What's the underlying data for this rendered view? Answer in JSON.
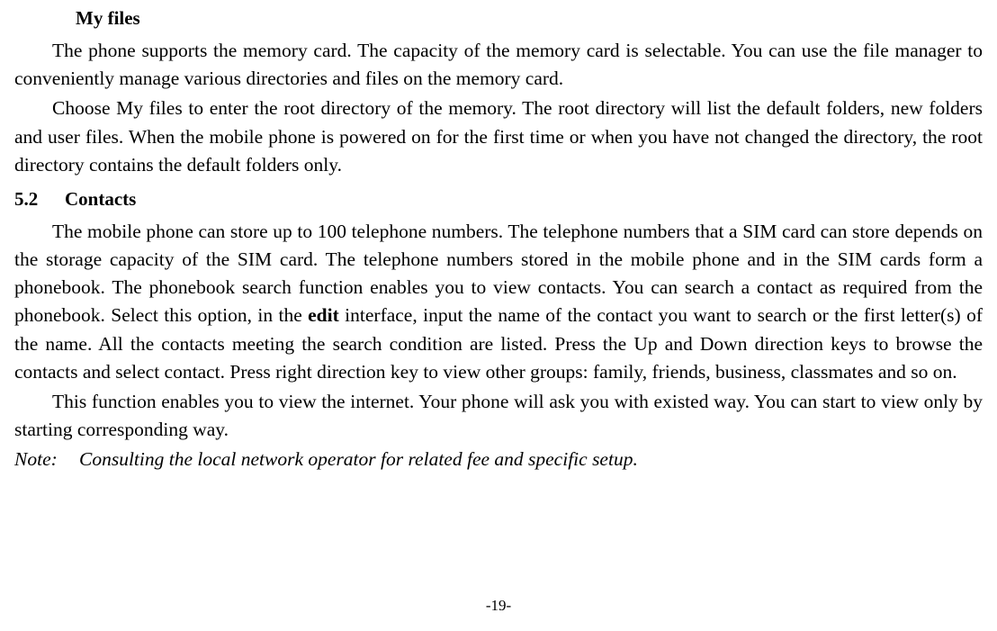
{
  "headings": {
    "myFiles": "My files",
    "contactsNum": "5.2",
    "contactsTitle": "Contacts"
  },
  "paragraphs": {
    "p1": "The phone supports the memory card. The capacity of the memory card is selectable. You can use the file manager to conveniently manage various directories and files on the memory card.",
    "p2": "Choose My files to enter the root directory of the memory. The root directory will list the default folders, new folders and user files. When the mobile phone is powered on for the first time or when you have not changed the directory, the root directory contains the default folders only.",
    "p3a": "The mobile phone can store up to 100 telephone numbers. The telephone numbers that a SIM card can store depends on the storage capacity of the SIM card. The telephone numbers stored in the mobile phone and in the SIM cards form a phonebook. The phonebook search function enables you to view contacts. You can search a contact as required from the phonebook. Select this option, in the ",
    "p3bold": "edit",
    "p3b": " interface, input the name of the contact you want to search or the first letter(s) of the name. All the contacts meeting the search condition are listed. Press the Up and Down direction keys to browse the contacts and select contact. Press right direction key to view other groups: family, friends, business, classmates and so on.",
    "p4": "This function enables you to view the internet. Your phone will ask you with existed way. You can start to view only by starting corresponding way."
  },
  "note": {
    "label": "Note:",
    "text": "Consulting the local network operator for related fee and specific setup."
  },
  "pageNumber": "-19-"
}
